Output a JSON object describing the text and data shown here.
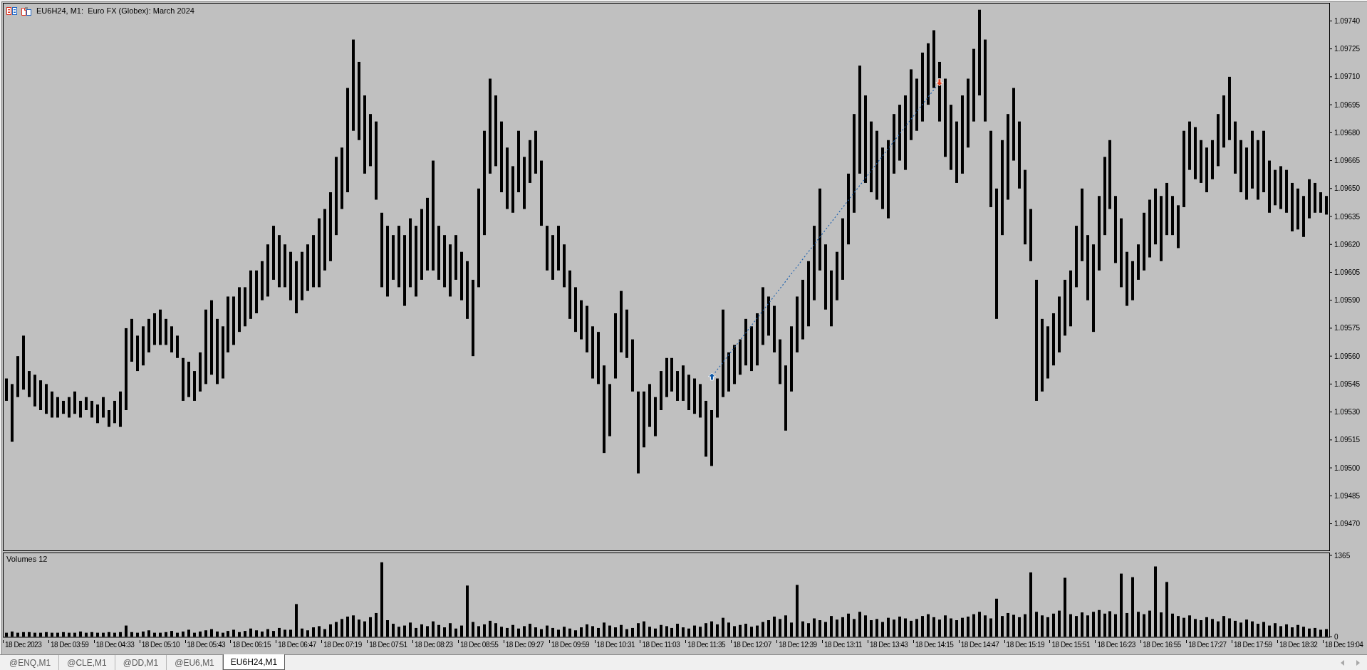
{
  "chart_window": {
    "title": "EU6H24, M1:  Euro FX (Globex): March 2024",
    "price_chart": {
      "axis_labels": [
        "1.09740",
        "1.09725",
        "1.09710",
        "1.09695",
        "1.09680",
        "1.09665",
        "1.09650",
        "1.09635",
        "1.09620",
        "1.09605",
        "1.09590",
        "1.09575",
        "1.09560",
        "1.09545",
        "1.09530",
        "1.09515",
        "1.09500",
        "1.09485",
        "1.09470"
      ]
    },
    "volume_panel": {
      "label": "Volumes 12",
      "chart_data": {
        "type": "bar",
        "ylim": [
          0,
          1407
        ],
        "yticks": [
          1365,
          0
        ],
        "categories": [
          null,
          null,
          null,
          null,
          null,
          null,
          null,
          null,
          null,
          null,
          null,
          null,
          null,
          null,
          null,
          null,
          null,
          null,
          null,
          null,
          null,
          null,
          null,
          null,
          null,
          null,
          null,
          null,
          null,
          null,
          null,
          null,
          null,
          null,
          null,
          null,
          null,
          null,
          null,
          null,
          null,
          null,
          null,
          null,
          null,
          null,
          null,
          null,
          null,
          null,
          null,
          null,
          null,
          null,
          null,
          null,
          null,
          null,
          null,
          null,
          null,
          null,
          null,
          null,
          null,
          null,
          null,
          null,
          null,
          null,
          null,
          null,
          null,
          null,
          null,
          null,
          null,
          null,
          null,
          null,
          null,
          null,
          null,
          null,
          null,
          null,
          null,
          null,
          null,
          null,
          null,
          null,
          null,
          null,
          null,
          null,
          null,
          null,
          null,
          null,
          null,
          null,
          null,
          null,
          null,
          null,
          null,
          null,
          null,
          null,
          null,
          null,
          null,
          null,
          null,
          null,
          null,
          null,
          null,
          null,
          null,
          null,
          null,
          null,
          null,
          null,
          null,
          null,
          null,
          null,
          null,
          null,
          null,
          null,
          null,
          null,
          null,
          null,
          null,
          null,
          null,
          null,
          null,
          null,
          null,
          null,
          null,
          null,
          null,
          null,
          null,
          null,
          null,
          null,
          null,
          null,
          null,
          null,
          null,
          null,
          null,
          null,
          null,
          null,
          null,
          null,
          null,
          null,
          null,
          null,
          null,
          null,
          null,
          null,
          null,
          null,
          null,
          null,
          null,
          null,
          null,
          null,
          null,
          null,
          null,
          null,
          null,
          null,
          null,
          null,
          null,
          null,
          null,
          null,
          null,
          null,
          null,
          null,
          null,
          null,
          null,
          null,
          null,
          null,
          null,
          null,
          null,
          null,
          null,
          null,
          null,
          null,
          null,
          null,
          null,
          null,
          null,
          null,
          null,
          null,
          null,
          null,
          null,
          null,
          null,
          null,
          null,
          null,
          null,
          null,
          null,
          null,
          null
        ],
        "series": [
          {
            "color": "#000000",
            "values": [
              70,
              90,
              70,
              80,
              80,
              70,
              70,
              80,
              70,
              70,
              80,
              70,
              70,
              90,
              70,
              80,
              70,
              70,
              80,
              70,
              80,
              190,
              80,
              70,
              90,
              110,
              70,
              70,
              80,
              100,
              70,
              90,
              120,
              70,
              90,
              110,
              130,
              90,
              70,
              100,
              120,
              80,
              100,
              140,
              110,
              90,
              130,
              100,
              150,
              120,
              120,
              550,
              140,
              110,
              160,
              180,
              130,
              210,
              250,
              300,
              340,
              360,
              290,
              260,
              330,
              400,
              1250,
              280,
              220,
              170,
              190,
              240,
              150,
              210,
              180,
              260,
              200,
              160,
              230,
              140,
              190,
              860,
              250,
              180,
              210,
              270,
              230,
              170,
              150,
              200,
              140,
              180,
              220,
              160,
              130,
              190,
              150,
              120,
              170,
              140,
              110,
              160,
              210,
              180,
              150,
              240,
              190,
              160,
              200,
              130,
              150,
              230,
              260,
              170,
              140,
              200,
              180,
              150,
              220,
              160,
              140,
              190,
              170,
              230,
              260,
              210,
              320,
              240,
              180,
              200,
              220,
              170,
              190,
              250,
              280,
              340,
              300,
              360,
              240,
              870,
              260,
              230,
              310,
              280,
              250,
              350,
              290,
              330,
              390,
              300,
              420,
              360,
              280,
              300,
              250,
              320,
              290,
              340,
              310,
              270,
              300,
              350,
              380,
              330,
              290,
              360,
              310,
              280,
              320,
              340,
              380,
              420,
              360,
              310,
              640,
              350,
              400,
              370,
              330,
              380,
              1080,
              420,
              360,
              330,
              390,
              440,
              990,
              380,
              350,
              410,
              360,
              420,
              450,
              390,
              430,
              380,
              1060,
              400,
              1000,
              420,
              380,
              440,
              1180,
              410,
              920,
              390,
              350,
              320,
              360,
              300,
              280,
              330,
              300,
              260,
              350,
              310,
              270,
              240,
              290,
              260,
              220,
              250,
              190,
              230,
              180,
              210,
              160,
              200,
              170,
              140,
              150,
              120,
              130
            ]
          }
        ]
      }
    },
    "time_axis": {
      "labels": [
        "18 Dec 2023",
        "18 Dec 03:59",
        "18 Dec 04:33",
        "18 Dec 05:10",
        "18 Dec 05:43",
        "18 Dec 06:15",
        "18 Dec 06:47",
        "18 Dec 07:19",
        "18 Dec 07:51",
        "18 Dec 08:23",
        "18 Dec 08:55",
        "18 Dec 09:27",
        "18 Dec 09:59",
        "18 Dec 10:31",
        "18 Dec 11:03",
        "18 Dec 11:35",
        "18 Dec 12:07",
        "18 Dec 12:39",
        "18 Dec 13:11",
        "18 Dec 13:43",
        "18 Dec 14:15",
        "18 Dec 14:47",
        "18 Dec 15:19",
        "18 Dec 15:51",
        "18 Dec 16:23",
        "18 Dec 16:55",
        "18 Dec 17:27",
        "18 Dec 17:59",
        "18 Dec 18:32",
        "18 Dec 19:04"
      ]
    }
  },
  "tabs": [
    {
      "label": "@ENQ,M1",
      "selected": false
    },
    {
      "label": "@CLE,M1",
      "selected": false
    },
    {
      "label": "@DD,M1",
      "selected": false
    },
    {
      "label": "@EU6,M1",
      "selected": false
    },
    {
      "label": "EU6H24,M1",
      "selected": true
    }
  ]
}
